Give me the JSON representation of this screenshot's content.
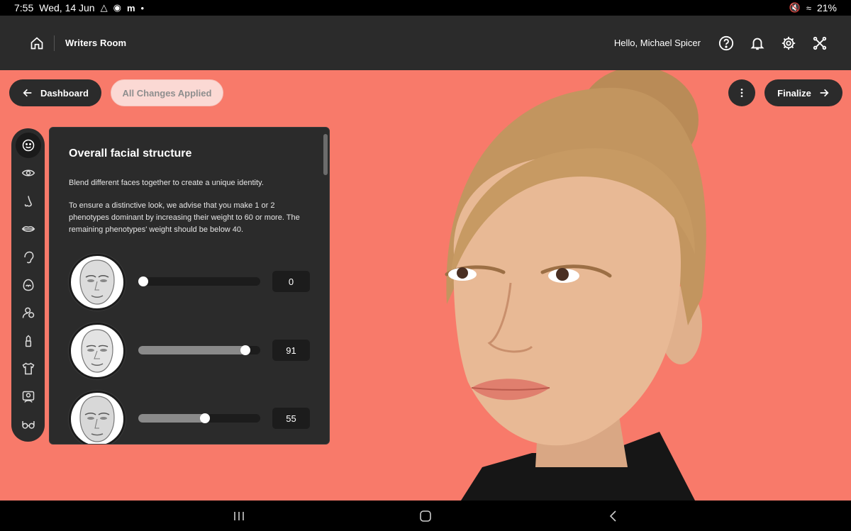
{
  "status_bar": {
    "time": "7:55",
    "date": "Wed, 14 Jun",
    "notification_icons": [
      "alert-icon",
      "facebook-icon",
      "medium-icon"
    ],
    "battery": "21%"
  },
  "header": {
    "title": "Writers Room",
    "greeting": "Hello, Michael Spicer",
    "icons": [
      "help-icon",
      "bell-icon",
      "gear-icon",
      "share-icon"
    ]
  },
  "toolbar": {
    "dashboard_label": "Dashboard",
    "applied_label": "All Changes Applied",
    "finalize_label": "Finalize"
  },
  "rail": {
    "items": [
      "face-icon",
      "eye-icon",
      "nose-icon",
      "lips-icon",
      "ear-icon",
      "head-icon",
      "skin-icon",
      "makeup-icon",
      "clothing-icon",
      "portrait-icon",
      "glasses-icon"
    ],
    "active": 0
  },
  "panel": {
    "title": "Overall facial structure",
    "intro": "Blend different faces together to create a unique identity.",
    "advice": "To ensure a distinctive look, we advise that you make 1 or 2 phenotypes dominant by increasing their weight to 60 or more. The remaining phenotypes' weight should be below 40.",
    "phenotypes": [
      {
        "value": "0",
        "weight": 0.0
      },
      {
        "value": "91",
        "weight": 0.91
      },
      {
        "value": "55",
        "weight": 0.55
      }
    ]
  },
  "colors": {
    "canvas_bg": "#f87a6a",
    "panel_bg": "#2b2b2b",
    "appbar_bg": "#2b2b2b"
  }
}
